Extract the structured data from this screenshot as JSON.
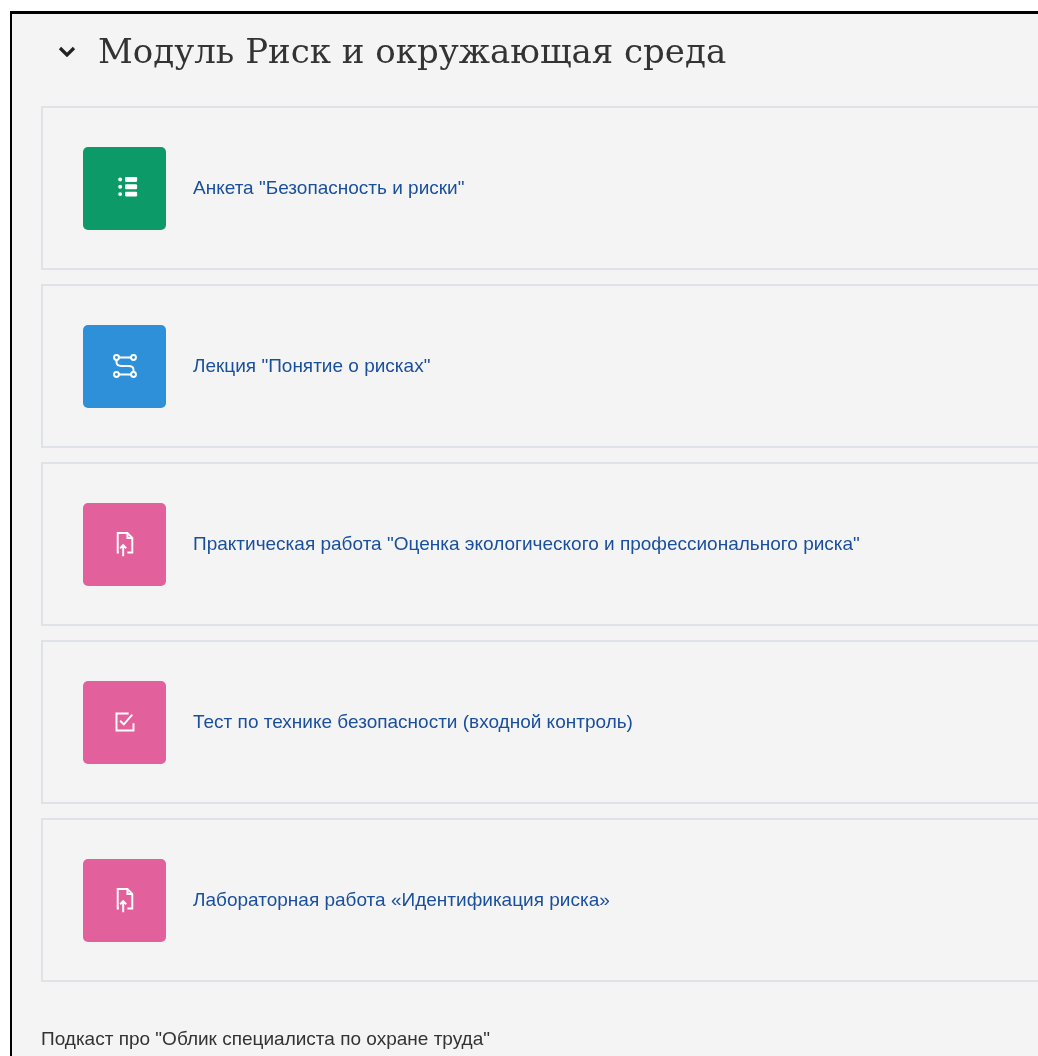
{
  "section": {
    "title": "Модуль Риск и окружающая среда",
    "expanded": true
  },
  "activities": [
    {
      "kind": "feedback",
      "name": "Анкета \"Безопасность и риски\""
    },
    {
      "kind": "lesson",
      "name": "Лекция \"Понятие о рисках\""
    },
    {
      "kind": "assign",
      "name": "Практическая работа \"Оценка экологического и профессионального риска\""
    },
    {
      "kind": "quiz",
      "name": "Тест по технике безопасности (входной контроль)"
    },
    {
      "kind": "assign",
      "name": "Лабораторная работа «Идентификация риска»"
    }
  ],
  "note": "Подкаст про \"Облик специалиста по охране труда\""
}
